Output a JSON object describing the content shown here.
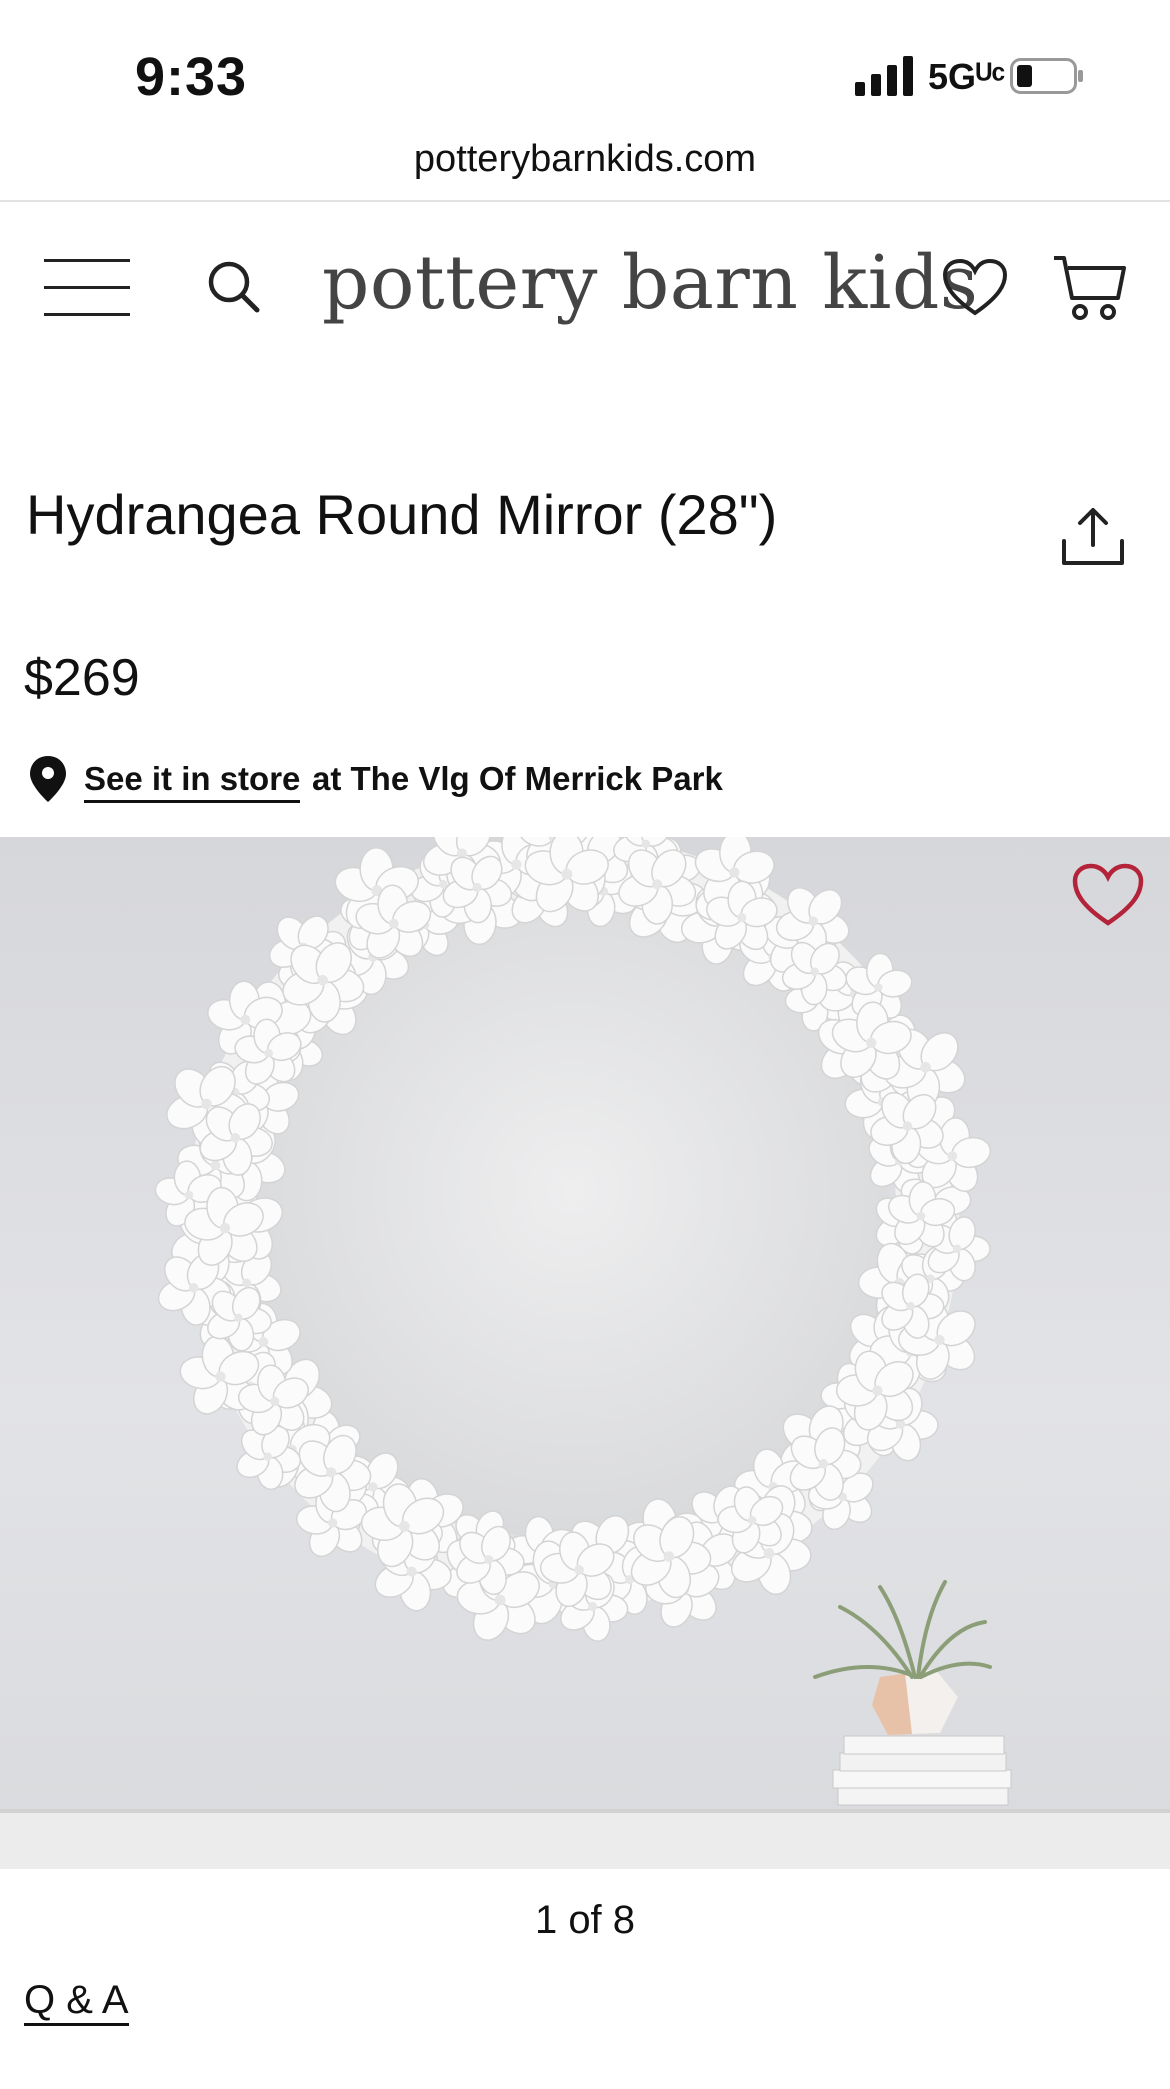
{
  "status_bar": {
    "time": "9:33",
    "network": "5Gᵁᶜ",
    "url": "potterybarnkids.com"
  },
  "header": {
    "brand": "pottery barn kids",
    "icons": [
      "menu-icon",
      "search-icon",
      "heart-icon",
      "cart-icon"
    ]
  },
  "product": {
    "title": "Hydrangea Round Mirror (28\")",
    "price": "$269",
    "store_link": "See it in store",
    "store_location": "at The Vlg Of Merrick Park"
  },
  "gallery": {
    "counter": "1 of 8",
    "favorite_color": "#b3243a"
  },
  "links": {
    "qa": "Q & A"
  }
}
